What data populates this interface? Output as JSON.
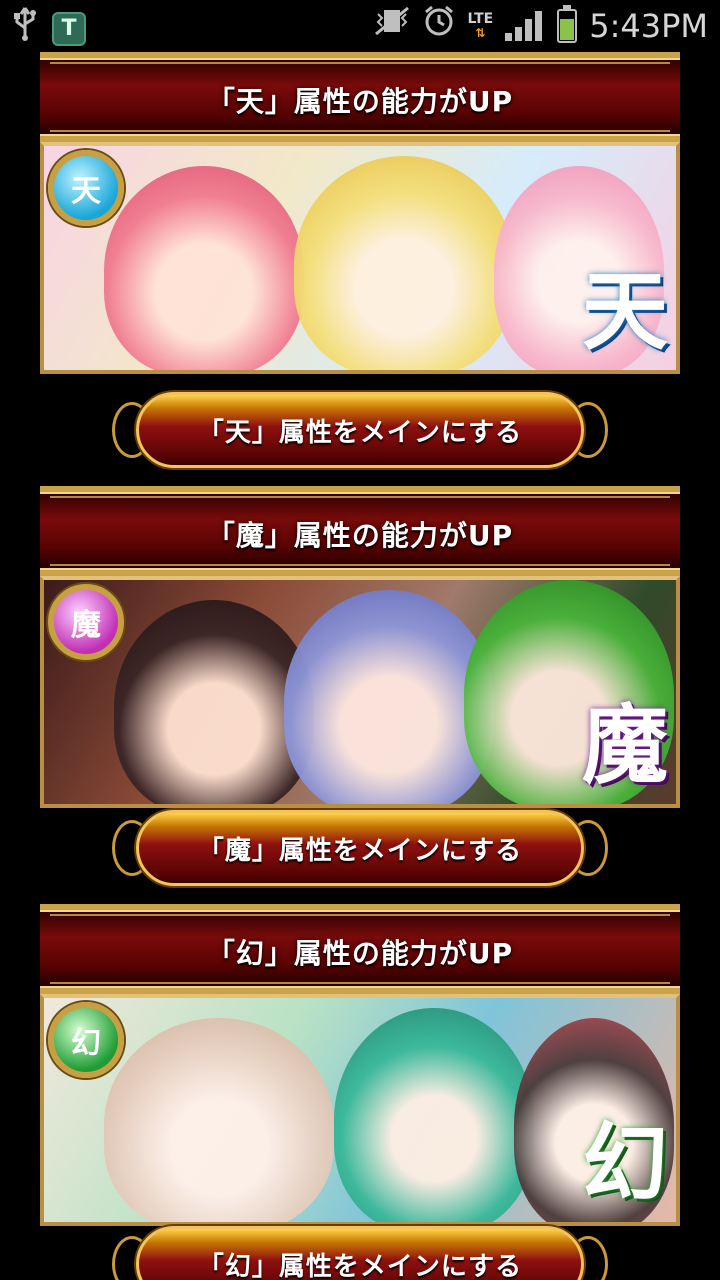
{
  "status_bar": {
    "time": "5:43PM",
    "network": "LTE",
    "left_icons": [
      "usb-icon",
      "app-t-icon"
    ],
    "right_icons": [
      "mute-vibrate-icon",
      "alarm-icon",
      "lte-icon",
      "signal-icon",
      "battery-icon"
    ],
    "app_badge": "T"
  },
  "sections": [
    {
      "banner_title": "「天」属性の能力がUP",
      "attribute": "天",
      "icon_glyph": "天",
      "button_label": "「天」属性をメインにする"
    },
    {
      "banner_title": "「魔」属性の能力がUP",
      "attribute": "魔",
      "icon_glyph": "魔",
      "button_label": "「魔」属性をメインにする"
    },
    {
      "banner_title": "「幻」属性の能力がUP",
      "attribute": "幻",
      "icon_glyph": "幻",
      "button_label": "「幻」属性をメインにする"
    }
  ],
  "colors": {
    "banner_red": "#7a0b0b",
    "gold_border": "#c9a24a",
    "ten_accent": "#1aa6d8",
    "ma_accent": "#c02fb4",
    "gen_accent": "#1f9d35"
  }
}
